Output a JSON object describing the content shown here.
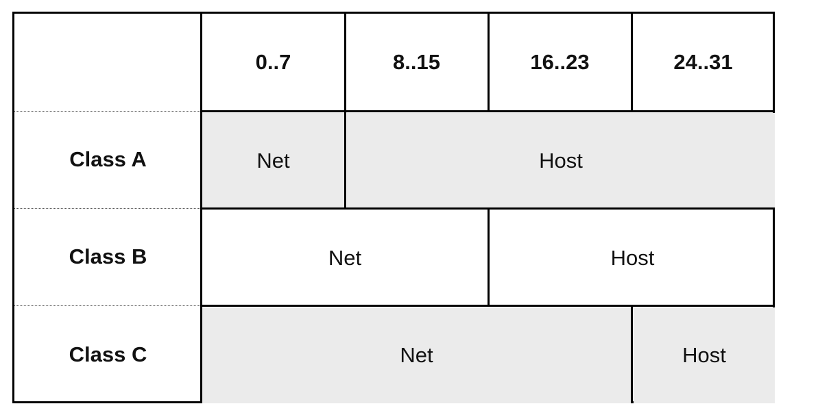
{
  "columns": [
    "0..7",
    "8..15",
    "16..23",
    "24..31"
  ],
  "rows": [
    {
      "label": "Class A",
      "net": "Net",
      "host": "Host"
    },
    {
      "label": "Class B",
      "net": "Net",
      "host": "Host"
    },
    {
      "label": "Class C",
      "net": "Net",
      "host": "Host"
    }
  ],
  "colors": {
    "shaded": "#ebebeb",
    "border": "#000000"
  }
}
